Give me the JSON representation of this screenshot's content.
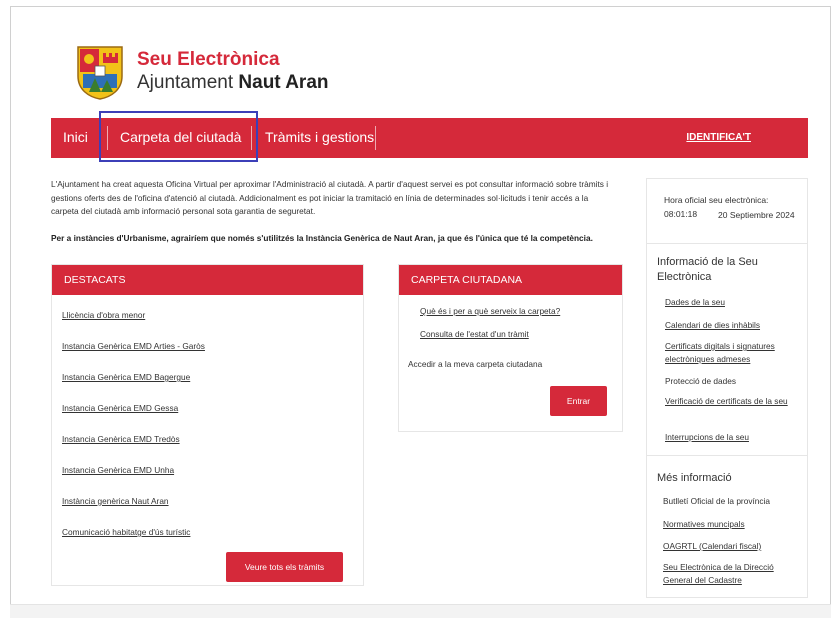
{
  "header": {
    "brand_title": "Seu Electrònica",
    "brand_prefix": "Ajuntament",
    "brand_name": "Naut Aran"
  },
  "nav": {
    "inici": "Inici",
    "carpeta": "Carpeta del ciutadà",
    "tramits": "Tràmits i gestions",
    "identifica": "IDENTIFICA'T"
  },
  "intro": {
    "text": "L'Ajuntament ha creat aquesta Oficina Virtual per aproximar l'Administració al ciutadà. A partir d'aquest servei es pot consultar informació sobre tràmits i gestions oferts des de l'oficina d'atenció al ciutadà. Addicionalment es pot iniciar la tramitació en línia de determinades sol·licituds i tenir accés a la carpeta del ciutadà amb informació personal sota garantia de seguretat.",
    "notice": "Per a instàncies d'Urbanisme, agrairíem que només s'utilitzés la Instància Genèrica de Naut Aran, ja que és l'única que té la competència."
  },
  "destacats": {
    "title": "DESTACATS",
    "items": [
      "Llicència d'obra menor",
      "Instancia Genèrica EMD Arties - Garòs",
      "Instancia Genèrica EMD Bagergue",
      "Instancia Genèrica EMD Gessa",
      "Instancia Genèrica EMD Tredòs",
      "Instancia Genèrica EMD Unha",
      "Instància genèrica Naut Aran",
      "Comunicació habitatge d'ús turístic"
    ],
    "button": "Veure tots els tràmits"
  },
  "carpeta": {
    "title": "CARPETA CIUTADANA",
    "link1": "Què és i per a què serveix la carpeta?",
    "link2": "Consulta de l'estat d'un tràmit",
    "access": "Accedir a la meva carpeta ciutadana",
    "button": "Entrar"
  },
  "sidebar": {
    "hora_label": "Hora oficial seu electrònica:",
    "hora_time": "08:01:18",
    "hora_date": "20 Septiembre 2024",
    "info_title": "Informació de la Seu Electrònica",
    "info_links": [
      "Dades de la seu",
      "Calendari de dies inhàbils",
      "Certificats digitals i signatures electròniques admeses",
      "Protecció de dades",
      "Verificació de certificats de la seu",
      "Interrupcions de la seu"
    ],
    "mes_title": "Més informació",
    "mes_links": [
      "Butlletí Oficial de la província",
      "Normatives muncipals",
      "OAGRTL (Calendari fiscal)",
      "Seu Electrònica de la Direcció General del Cadastre"
    ]
  },
  "colors": {
    "accent": "#d5293a",
    "highlight_frame": "#3c3fb8"
  }
}
